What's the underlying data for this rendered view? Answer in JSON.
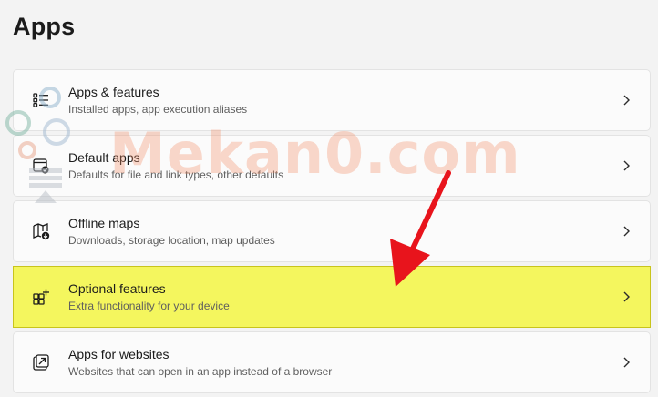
{
  "page": {
    "title": "Apps"
  },
  "items": [
    {
      "title": "Apps & features",
      "desc": "Installed apps, app execution aliases",
      "icon": "apps-features-icon"
    },
    {
      "title": "Default apps",
      "desc": "Defaults for file and link types, other defaults",
      "icon": "default-apps-icon"
    },
    {
      "title": "Offline maps",
      "desc": "Downloads, storage location, map updates",
      "icon": "offline-maps-icon"
    },
    {
      "title": "Optional features",
      "desc": "Extra functionality for your device",
      "icon": "optional-features-icon"
    },
    {
      "title": "Apps for websites",
      "desc": "Websites that can open in an app instead of a browser",
      "icon": "apps-for-websites-icon"
    }
  ],
  "watermark": {
    "text": "Mekan0.com"
  },
  "colors": {
    "background": "#f3f3f3",
    "card": "#fbfbfb",
    "highlight": "#f4f65e",
    "arrow": "#e8141c"
  }
}
